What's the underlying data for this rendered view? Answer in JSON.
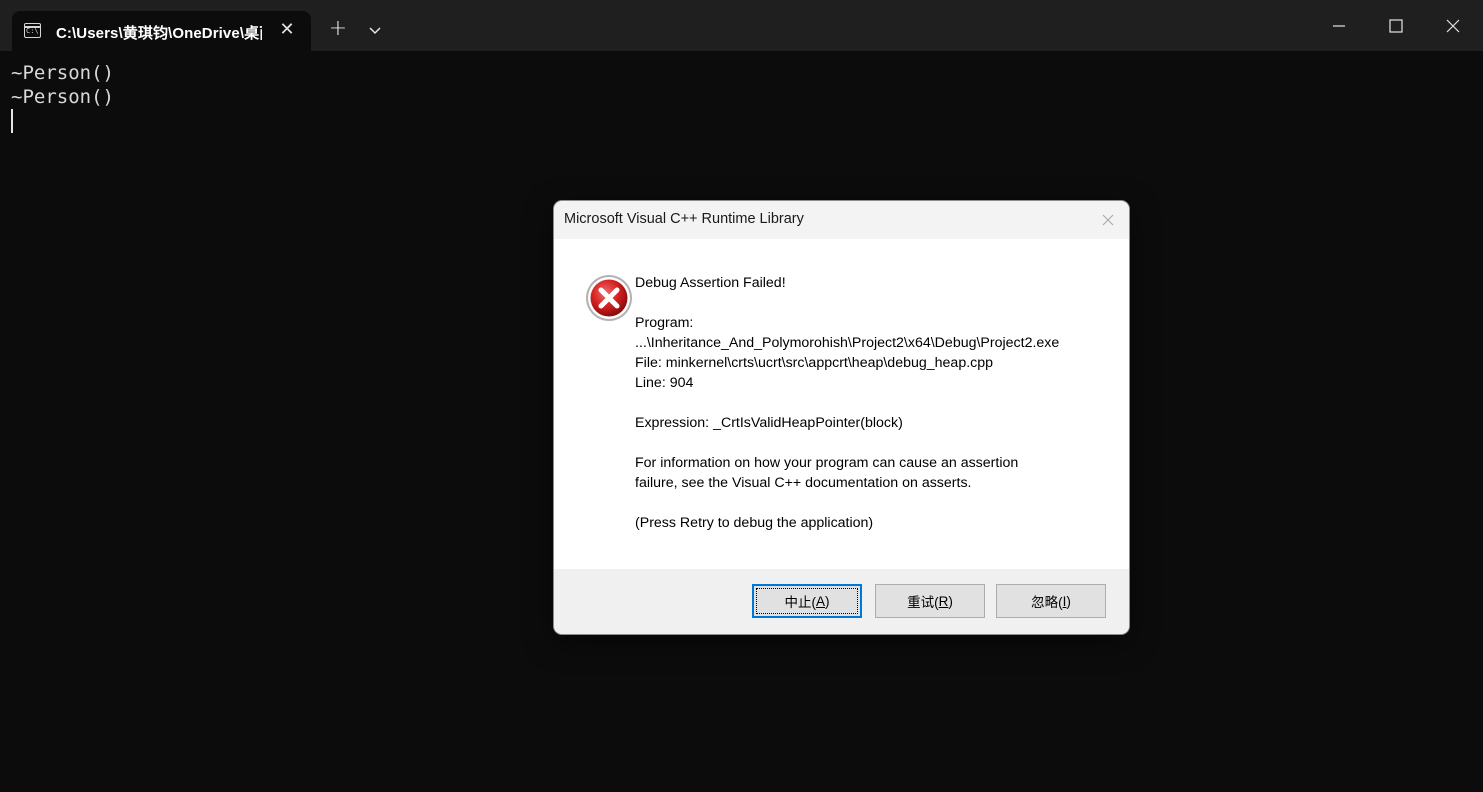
{
  "terminal": {
    "tab_title": "C:\\Users\\黄琪钧\\OneDrive\\桌面",
    "tab_icon": "command-prompt-icon",
    "output_lines": [
      "~Person()",
      "~Person()"
    ]
  },
  "dialog": {
    "title": "Microsoft Visual C++ Runtime Library",
    "icon": "error-icon",
    "message": {
      "heading": "Debug Assertion Failed!",
      "program_label": "Program:",
      "program_path": "...\\Inheritance_And_Polymorohish\\Project2\\x64\\Debug\\Project2.exe",
      "file": "File: minkernel\\crts\\ucrt\\src\\appcrt\\heap\\debug_heap.cpp",
      "line": "Line: 904",
      "expression": "Expression: _CrtIsValidHeapPointer(block)",
      "info_1": "For information on how your program can cause an assertion",
      "info_2": "failure, see the Visual C++ documentation on asserts.",
      "press_retry": "(Press Retry to debug the application)"
    },
    "buttons": {
      "abort": {
        "label": "中止(",
        "mnemonic": "A",
        "suffix": ")"
      },
      "retry": {
        "label": "重试(",
        "mnemonic": "R",
        "suffix": ")"
      },
      "ignore": {
        "label": "忽略(",
        "mnemonic": "I",
        "suffix": ")"
      }
    }
  }
}
